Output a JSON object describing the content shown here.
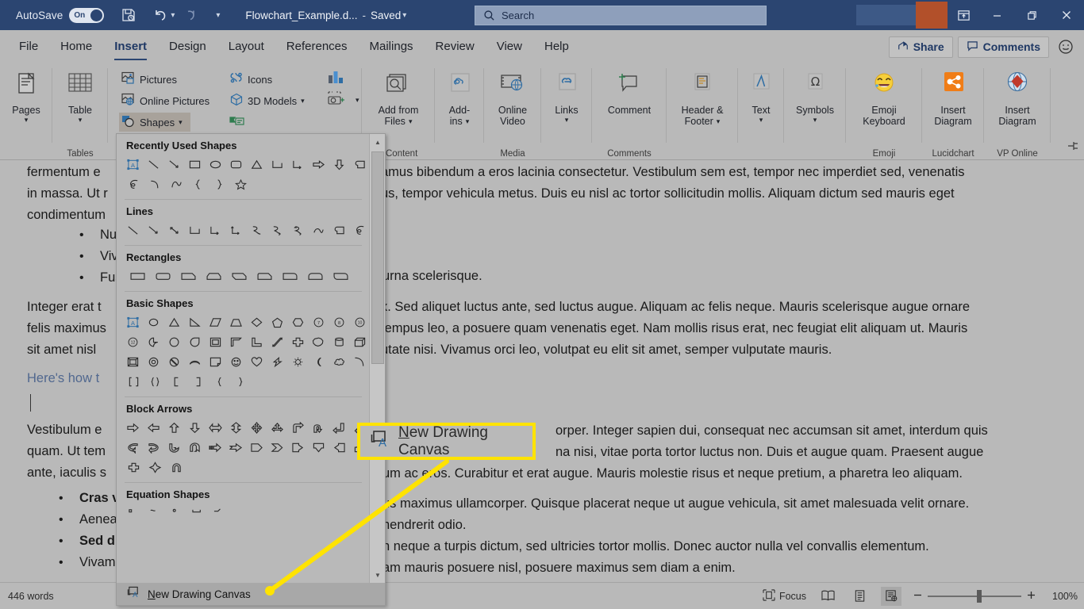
{
  "titlebar": {
    "autosave_label": "AutoSave",
    "autosave_state": "On",
    "save_icon": "save-icon",
    "undo_icon": "undo-icon",
    "redo_icon": "redo-icon",
    "customize_qat_icon": "chevron-down-icon",
    "doc_title": "Flowchart_Example.d...",
    "doc_sep": "-",
    "doc_state": "Saved",
    "doc_menu_icon": "chevron-down-icon",
    "minimize_icon": "minimize-icon",
    "restore_icon": "restore-icon",
    "close_icon": "close-icon",
    "ribbon_display_icon": "ribbon-display-options-icon",
    "accent_bg": "#2b4571"
  },
  "search": {
    "placeholder": "Search",
    "icon": "search-icon"
  },
  "tabs": [
    {
      "label": "File",
      "active": false
    },
    {
      "label": "Home",
      "active": false
    },
    {
      "label": "Insert",
      "active": true
    },
    {
      "label": "Design",
      "active": false
    },
    {
      "label": "Layout",
      "active": false
    },
    {
      "label": "References",
      "active": false
    },
    {
      "label": "Mailings",
      "active": false
    },
    {
      "label": "Review",
      "active": false
    },
    {
      "label": "View",
      "active": false
    },
    {
      "label": "Help",
      "active": false
    }
  ],
  "tab_right": {
    "share_label": "Share",
    "share_icon": "share-icon",
    "comments_label": "Comments",
    "comments_icon": "comment-icon",
    "feedback_icon": "smiley-icon"
  },
  "ribbon": {
    "groups": [
      {
        "name": "",
        "items": [
          {
            "label": "Pages",
            "icon": "pages-icon",
            "caret": true
          }
        ]
      },
      {
        "name": "Tables",
        "items": [
          {
            "label": "Table",
            "icon": "table-icon",
            "caret": true
          }
        ]
      },
      {
        "name": "",
        "items": [
          {
            "label": "Pictures",
            "icon": "pictures-icon"
          },
          {
            "label": "Online Pictures",
            "icon": "online-pictures-icon"
          },
          {
            "label": "Shapes",
            "icon": "shapes-icon",
            "caret": true,
            "selected": true
          },
          {
            "label": "Icons",
            "icon": "icons-icon"
          },
          {
            "label": "3D Models",
            "icon": "3d-models-icon",
            "caret": true
          },
          {
            "label": "",
            "icon": "chart-icon"
          },
          {
            "label": "",
            "icon": "screenshot-icon",
            "caret": true
          },
          {
            "label": "",
            "icon": "smartart-icon"
          }
        ]
      },
      {
        "name": "Content",
        "items": [
          {
            "label": "Add from Files",
            "icon": "add-from-files-icon",
            "caret": true
          }
        ]
      },
      {
        "name": "",
        "items": [
          {
            "label": "Add-ins",
            "icon": "add-ins-icon",
            "caret": true
          }
        ]
      },
      {
        "name": "Media",
        "items": [
          {
            "label": "Online Video",
            "icon": "online-video-icon"
          }
        ]
      },
      {
        "name": "",
        "items": [
          {
            "label": "Links",
            "icon": "links-icon",
            "caret": true
          }
        ]
      },
      {
        "name": "Comments",
        "items": [
          {
            "label": "Comment",
            "icon": "new-comment-icon"
          }
        ]
      },
      {
        "name": "",
        "items": [
          {
            "label": "Header & Footer",
            "icon": "header-footer-icon",
            "caret": true
          }
        ]
      },
      {
        "name": "",
        "items": [
          {
            "label": "Text",
            "icon": "text-icon",
            "caret": true
          }
        ]
      },
      {
        "name": "",
        "items": [
          {
            "label": "Symbols",
            "icon": "symbols-icon",
            "caret": true
          }
        ]
      },
      {
        "name": "Emoji",
        "items": [
          {
            "label": "Emoji Keyboard",
            "icon": "emoji-keyboard-icon"
          }
        ]
      },
      {
        "name": "Lucidchart",
        "items": [
          {
            "label": "Insert Diagram",
            "icon": "lucidchart-icon"
          }
        ]
      },
      {
        "name": "VP Online",
        "items": [
          {
            "label": "Insert Diagram",
            "icon": "vp-online-icon"
          }
        ]
      }
    ],
    "labels": {
      "pages": "Pages",
      "table": "Table",
      "tables_group": "Tables",
      "pictures": "Pictures",
      "online_pictures": "Online Pictures",
      "shapes": "Shapes",
      "icons": "Icons",
      "models3d": "3D Models",
      "add_from_files": "Add from",
      "add_from_files2": "Files",
      "content_group": "Content",
      "addins": "Add-",
      "addins2": "ins",
      "online_video": "Online",
      "online_video2": "Video",
      "media_group": "Media",
      "links": "Links",
      "comment": "Comment",
      "comments_group": "Comments",
      "header_footer": "Header &",
      "header_footer2": "Footer",
      "text": "Text",
      "symbols": "Symbols",
      "emoji": "Emoji",
      "emoji2": "Keyboard",
      "emoji_group": "Emoji",
      "lucid": "Insert",
      "lucid2": "Diagram",
      "lucid_group": "Lucidchart",
      "vp": "Insert",
      "vp2": "Diagram",
      "vp_group": "VP Online"
    }
  },
  "gallery": {
    "sections": [
      {
        "title": "Recently Used Shapes",
        "rows": [
          [
            "textbox",
            "line",
            "line-arrow",
            "rectangle",
            "oval",
            "rounded-rect",
            "triangle",
            "elbow-connector",
            "elbow-arrow-connector",
            "right-arrow",
            "down-arrow",
            "flowchart-card"
          ],
          [
            "freeform-scribble",
            "arc",
            "curve",
            "left-brace",
            "right-brace",
            "star-5"
          ]
        ]
      },
      {
        "title": "Lines",
        "rows": [
          [
            "line",
            "line-arrow",
            "line-double-arrow",
            "elbow-connector",
            "elbow-arrow-connector",
            "elbow-double-arrow",
            "curved-connector",
            "curved-arrow-connector",
            "curved-double-arrow",
            "arc",
            "freeform-shape",
            "scribble"
          ]
        ]
      },
      {
        "title": "Rectangles",
        "rows": [
          [
            "rectangle",
            "rounded-rect",
            "snip-single-corner",
            "snip-same-side-corner",
            "snip-diagonal-corner",
            "snip-round-same-side",
            "round-single-corner",
            "round-same-side-corner",
            "round-diagonal-corner"
          ]
        ]
      },
      {
        "title": "Basic Shapes",
        "rows": [
          [
            "textbox",
            "oval",
            "isosceles-triangle",
            "right-triangle",
            "parallelogram",
            "trapezoid",
            "diamond",
            "pentagon",
            "hexagon",
            "heptagon",
            "octagon",
            "decagon"
          ],
          [
            "dodecagon",
            "pie",
            "chord",
            "teardrop",
            "frame",
            "half-frame",
            "l-shape",
            "diagonal-stripe",
            "cross",
            "regular-pentagon-star",
            "cylinder",
            "cube"
          ],
          [
            "bevel",
            "donut",
            "no-symbol",
            "block-arc",
            "folded-corner",
            "smiley-face",
            "heart",
            "lightning-bolt",
            "sun",
            "moon",
            "cloud",
            "arc-shape"
          ],
          [
            "left-bracket",
            "double-brace",
            "left-square-bracket",
            "right-square-bracket",
            "left-brace-shape",
            "right-brace-shape"
          ]
        ]
      },
      {
        "title": "Block Arrows",
        "rows": [
          [
            "arrow-right",
            "arrow-left",
            "arrow-up",
            "arrow-down",
            "left-right-arrow",
            "up-down-arrow",
            "quad-arrow",
            "left-right-up-arrow",
            "bent-arrow",
            "u-turn-arrow",
            "left-up-arrow",
            "bent-up-arrow"
          ],
          [
            "curved-left-arrow",
            "curved-right-arrow",
            "curved-up-arrow",
            "curved-down-arrow",
            "striped-right-arrow",
            "notched-right-arrow",
            "pentagon-arrow",
            "chevron-arrow",
            "right-arrow-callout",
            "down-arrow-callout",
            "left-arrow-callout",
            "up-arrow-callout"
          ],
          [
            "cross-arrow",
            "four-point-star-arrow",
            "circular-arrow"
          ]
        ]
      },
      {
        "title": "Equation Shapes",
        "rows": [
          [
            "plus-sign",
            "equal-sign",
            "division-sign",
            "minus-sign",
            "multiply-sign"
          ]
        ]
      }
    ],
    "footer_label": "New Drawing Canvas",
    "footer_icon": "new-drawing-canvas-icon",
    "scroll_up_icon": "scroll-up-arrow",
    "scroll_down_icon": "scroll-down-arrow"
  },
  "callout": {
    "label": "New Drawing Canvas",
    "icon": "new-drawing-canvas-icon",
    "highlight_color": "#ffe300"
  },
  "document": {
    "left_lines": [
      "fermentum e",
      "in massa. Ut r",
      "condimentum"
    ],
    "left_bullets": [
      "Nunc",
      "Vivam",
      "Fusce"
    ],
    "left_para2": [
      "Integer erat t",
      "felis maximus",
      "sit amet nisl"
    ],
    "left_heading": "Here's how t",
    "left_para3": [
      "Vestibulum e",
      "quam. Ut tem",
      "ante, iaculis s"
    ],
    "left_bullets2": [
      {
        "bold": "Cras v",
        "plain": "Aenea"
      },
      {
        "bold": "Sed d",
        "plain": "Vivam"
      }
    ],
    "right_para1": [
      "amus bibendum a eros lacinia consectetur. Vestibulum sem est, tempor nec imperdiet sed, venenatis",
      "us, tempor vehicula metus. Duis eu nisl ac tortor sollicitudin mollis. Aliquam dictum sed mauris eget"
    ],
    "right_para2": [
      "urna scelerisque."
    ],
    "right_para3": [
      "x. Sed aliquet luctus ante, sed luctus augue. Aliquam ac felis neque. Mauris scelerisque augue ornare",
      "tempus leo, a posuere quam venenatis eget. Nam mollis risus erat, nec feugiat elit aliquam ut. Mauris",
      "utate nisi. Vivamus orci leo, volutpat eu elit sit amet, semper vulputate mauris."
    ],
    "right_para4": [
      "orper. Integer sapien dui, consequat nec accumsan sit amet, interdum quis",
      "na nisi, vitae porta tortor luctus non. Duis et augue quam. Praesent augue",
      "um ac eros. Curabitur et erat augue. Mauris molestie risus et neque pretium, a pharetra leo aliquam."
    ],
    "right_para5": [
      "us maximus ullamcorper. Quisque placerat neque ut augue vehicula, sit amet malesuada velit ornare.",
      "hendrerit odio."
    ],
    "right_para6": [
      "n neque a turpis dictum, sed ultricies tortor mollis. Donec auctor nulla vel convallis elementum.",
      "am mauris posuere nisl, posuere maximus sem diam a enim."
    ]
  },
  "statusbar": {
    "word_count": "446 words",
    "footer_canvas_label": "New Drawing Canvas",
    "focus_label": "Focus",
    "focus_icon": "focus-icon",
    "read_mode_icon": "read-mode-icon",
    "print_layout_icon": "print-layout-icon",
    "web_layout_icon": "web-layout-icon",
    "zoom_out_icon": "minus-icon",
    "zoom_in_icon": "plus-icon",
    "zoom_level": "100%"
  }
}
